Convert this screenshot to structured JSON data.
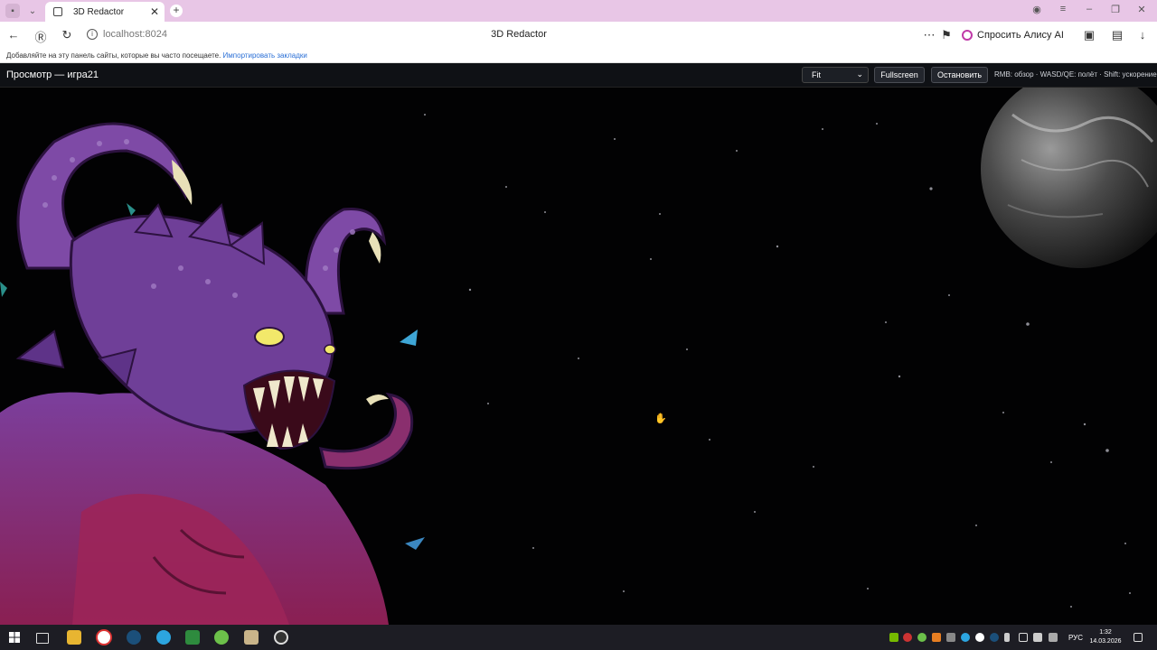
{
  "browser": {
    "tab_title": "3D Redactor",
    "url": "localhost:8024",
    "page_title": "3D Redactor",
    "alice_label": "Спросить Алису AI",
    "bookmarks_prompt": "Добавляйте на эту панель сайты, которые вы часто посещаете.",
    "bookmarks_link": "Импортировать закладки"
  },
  "app": {
    "title": "Просмотр — игра21",
    "fit_value": "Fit",
    "fullscreen_label": "Fullscreen",
    "stop_label": "Остановить",
    "hint": "RMB: обзор · WASD/QE: полёт · Shift: ускорение"
  },
  "taskbar": {
    "lang": "РУС",
    "time": "1:32",
    "date": "14.03.2026"
  },
  "icons": {
    "back": "arrow-left-icon",
    "reader": "reader-icon",
    "reload": "reload-icon",
    "site_info": "site-info-icon",
    "more": "more-icon",
    "bookmark": "bookmark-icon"
  }
}
